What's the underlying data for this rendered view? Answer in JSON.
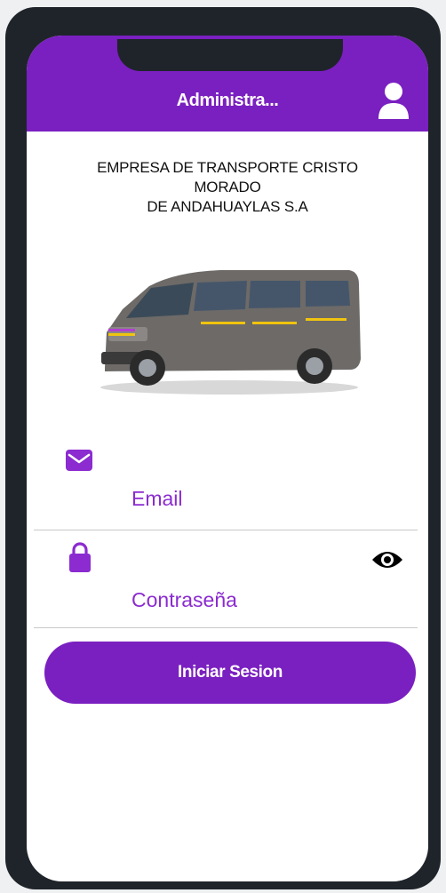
{
  "appbar": {
    "title": "Administra...",
    "user_icon": "user-icon"
  },
  "company": {
    "line1": "EMPRESA DE TRANSPORTE CRISTO",
    "line2": "MORADO",
    "line3": "DE ANDAHUAYLAS S.A"
  },
  "form": {
    "email_label": "Email",
    "email_icon": "envelope-icon",
    "password_label": "Contraseña",
    "password_icon": "lock-icon",
    "visibility_icon": "eye-icon"
  },
  "login_button": {
    "label": "Iniciar Sesion"
  },
  "colors": {
    "primary": "#7a1fc0",
    "label": "#8b2bd0",
    "frame": "#1f242a"
  }
}
